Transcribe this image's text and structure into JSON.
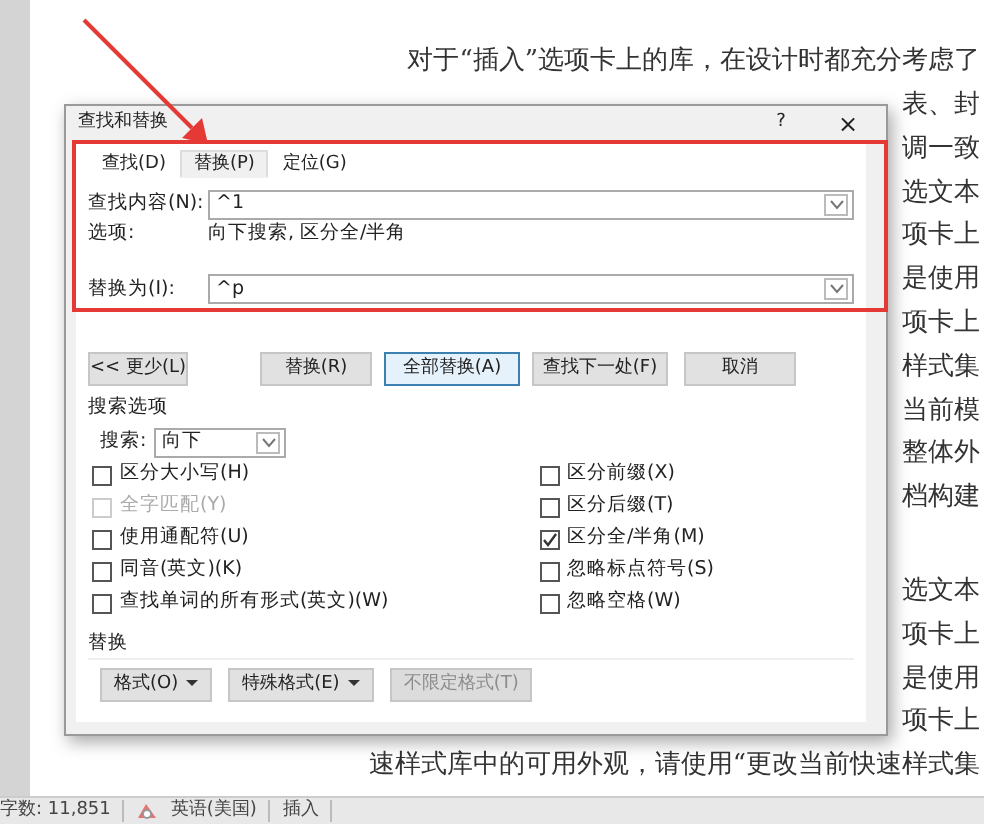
{
  "document": {
    "paragraphs": [
      [
        "对于“插入”选项卡上的库，在设计时都充分考虑了",
        "表、封",
        "调一致",
        "选文本",
        "项卡上",
        "是使用",
        "项卡上",
        "样式集",
        "当前模",
        "整体外",
        "档构建"
      ],
      [
        "选文本",
        "项卡上",
        "是使用",
        "项卡上",
        "速样式库中的可用外观，请使用“更改当前快速样式集"
      ]
    ]
  },
  "dialog": {
    "title": "查找和替换",
    "help": "?",
    "close": "×",
    "tabs": [
      {
        "label": "查找(D)",
        "selected": false
      },
      {
        "label": "替换(P)",
        "selected": true
      },
      {
        "label": "定位(G)",
        "selected": false
      }
    ],
    "find": {
      "label": "查找内容(N):",
      "value": "^1"
    },
    "options": {
      "label": "选项:",
      "value": "向下搜索, 区分全/半角"
    },
    "replace": {
      "label": "替换为(I):",
      "value": "^p"
    },
    "buttons": [
      {
        "label": "<< 更少(L)",
        "kind": "less",
        "selected": false
      },
      {
        "label": "替换(R)",
        "kind": "action",
        "selected": false
      },
      {
        "label": "全部替换(A)",
        "kind": "action",
        "selected": true
      },
      {
        "label": "查找下一处(F)",
        "kind": "action",
        "selected": false
      },
      {
        "label": "取消",
        "kind": "action",
        "selected": false
      }
    ],
    "search_options": {
      "title": "搜索选项",
      "direction_label": "搜索:",
      "direction": "向下",
      "left": [
        {
          "label": "区分大小写(H)",
          "checked": false,
          "disabled": false
        },
        {
          "label": "全字匹配(Y)",
          "checked": false,
          "disabled": true
        },
        {
          "label": "使用通配符(U)",
          "checked": false,
          "disabled": false
        },
        {
          "label": "同音(英文)(K)",
          "checked": false,
          "disabled": false
        },
        {
          "label": "查找单词的所有形式(英文)(W)",
          "checked": false,
          "disabled": false
        }
      ],
      "right": [
        {
          "label": "区分前缀(X)",
          "checked": false,
          "disabled": false
        },
        {
          "label": "区分后缀(T)",
          "checked": false,
          "disabled": false
        },
        {
          "label": "区分全/半角(M)",
          "checked": true,
          "disabled": false
        },
        {
          "label": "忽略标点符号(S)",
          "checked": false,
          "disabled": false
        },
        {
          "label": "忽略空格(W)",
          "checked": false,
          "disabled": false
        }
      ]
    },
    "replace_section": {
      "title": "替换",
      "buttons": [
        {
          "label": "格式(O)",
          "caret": true,
          "disabled": false
        },
        {
          "label": "特殊格式(E)",
          "caret": true,
          "disabled": false
        },
        {
          "label": "不限定格式(T)",
          "caret": false,
          "disabled": true
        }
      ]
    }
  },
  "status_bar": {
    "word_count": "字数: 11,851",
    "language": "英语(美国)",
    "mode": "插入"
  }
}
